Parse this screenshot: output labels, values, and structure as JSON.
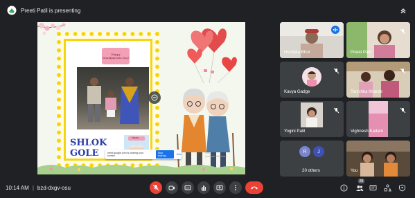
{
  "topbar": {
    "presenting_text": "Preeti Patil is presenting"
  },
  "slide": {
    "badge_text": "Happy Grandparents Day!",
    "name_text": "SHLOK GOLE",
    "mini_card_text": "Happy",
    "share_notice": "meet.google.com is sharing your screen.",
    "stop_sharing_label": "Stop sharing",
    "hide_label": "Hide",
    "activate_text": "ows\nActivate Windows"
  },
  "participants": [
    {
      "name": "Hemlata Bhor",
      "state": "speaking"
    },
    {
      "name": "Preeti Patil",
      "state": "muted"
    },
    {
      "name": "Kavya Gadge",
      "state": "muted"
    },
    {
      "name": "Tanishka Kharde",
      "state": "muted"
    },
    {
      "name": "Yogini Patil",
      "state": "muted"
    },
    {
      "name": "Vighnesh Kadam",
      "state": "muted"
    },
    {
      "name": "20 others",
      "initials": [
        "R",
        "J"
      ]
    },
    {
      "name": "You",
      "state": "self"
    }
  ],
  "bottombar": {
    "time": "10:14 AM",
    "separator": "|",
    "meeting_code": "bzd-dxgv-osu",
    "participant_count": "28"
  },
  "colors": {
    "background": "#202124",
    "tile": "#3c4043",
    "end_call": "#ea4335",
    "accent": "#1a73e8",
    "frame_yellow": "#f5d60c"
  },
  "icons": [
    "meet-logo-icon",
    "collapse-icon",
    "mic-off-icon",
    "camera-icon",
    "captions-icon",
    "raise-hand-icon",
    "present-icon",
    "more-options-icon",
    "end-call-icon",
    "info-icon",
    "people-icon",
    "chat-icon",
    "activities-icon",
    "host-controls-icon"
  ]
}
